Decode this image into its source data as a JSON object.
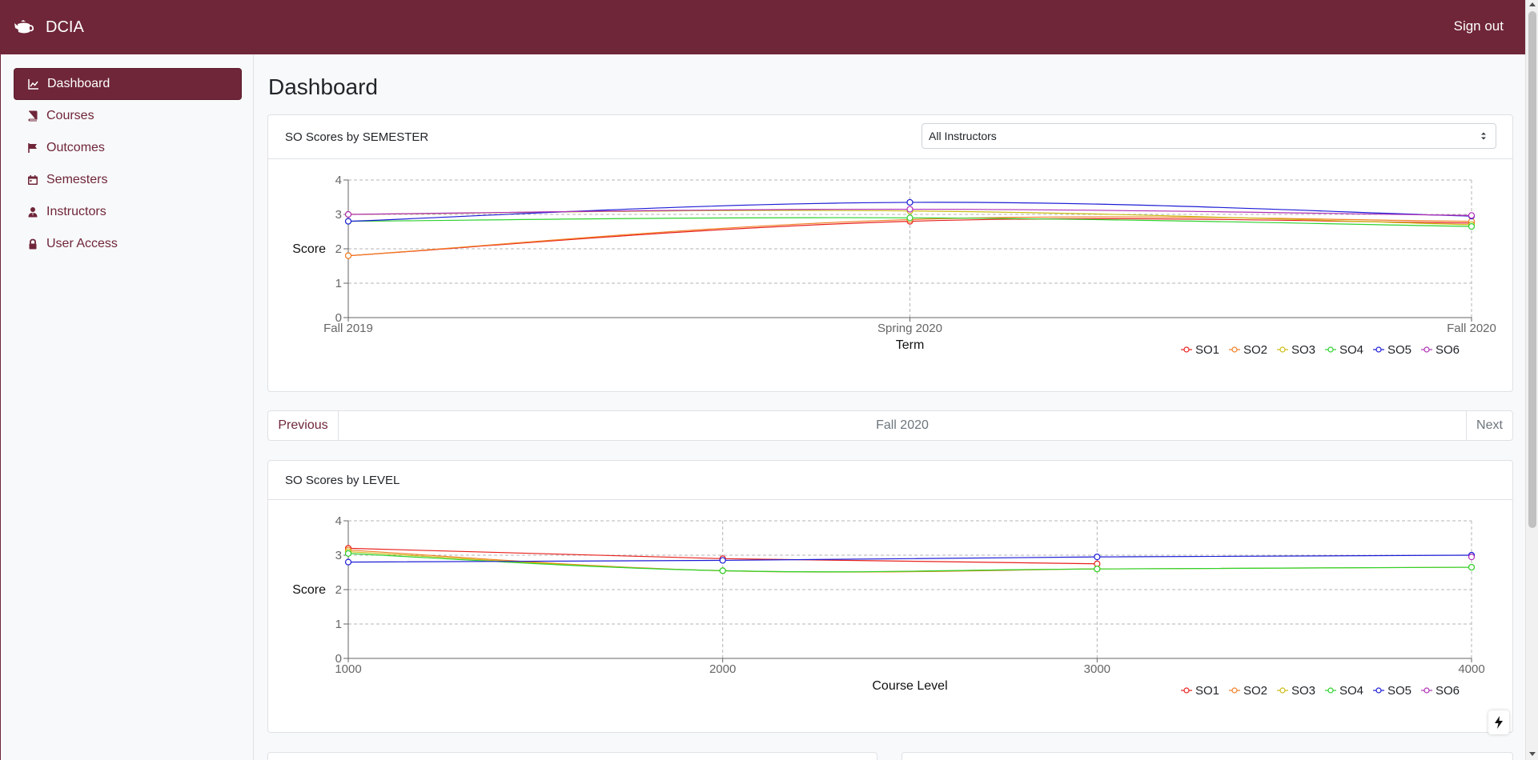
{
  "app": {
    "brand_name": "DCIA",
    "signout_label": "Sign out",
    "accent_color": "#6f2639"
  },
  "sidebar": {
    "items": [
      {
        "label": "Dashboard",
        "icon": "chart-line-icon",
        "active": true
      },
      {
        "label": "Courses",
        "icon": "book-icon",
        "active": false
      },
      {
        "label": "Outcomes",
        "icon": "flag-icon",
        "active": false
      },
      {
        "label": "Semesters",
        "icon": "calendar-icon",
        "active": false
      },
      {
        "label": "Instructors",
        "icon": "user-tie-icon",
        "active": false
      },
      {
        "label": "User Access",
        "icon": "lock-icon",
        "active": false
      }
    ]
  },
  "main": {
    "page_title": "Dashboard",
    "semester_card": {
      "title": "SO Scores by SEMESTER",
      "instructor_select_value": "All Instructors"
    },
    "pager": {
      "previous_label": "Previous",
      "current_label": "Fall 2020",
      "next_label": "Next"
    },
    "level_card": {
      "title": "SO Scores by LEVEL"
    }
  },
  "chart_data": [
    {
      "type": "line",
      "xlabel": "Term",
      "ylabel": "Score",
      "categories": [
        "Fall 2019",
        "Spring 2020",
        "Fall 2020"
      ],
      "ylim": [
        0,
        4
      ],
      "yticks": [
        0,
        1,
        2,
        3,
        4
      ],
      "grid": true,
      "legend": "bottom-right",
      "series": [
        {
          "name": "SO1",
          "color": "#e8201c",
          "values": [
            1.8,
            2.8,
            2.75
          ]
        },
        {
          "name": "SO2",
          "color": "#f07f24",
          "values": [
            1.8,
            2.85,
            2.8
          ]
        },
        {
          "name": "SO3",
          "color": "#c9bc14",
          "values": [
            3.0,
            3.1,
            2.7
          ]
        },
        {
          "name": "SO4",
          "color": "#2dd12d",
          "values": [
            2.8,
            2.9,
            2.65
          ]
        },
        {
          "name": "SO5",
          "color": "#1c1cd6",
          "values": [
            2.8,
            3.35,
            2.95
          ]
        },
        {
          "name": "SO6",
          "color": "#b02fb5",
          "values": [
            3.0,
            3.15,
            2.97
          ]
        }
      ]
    },
    {
      "type": "line",
      "xlabel": "Course Level",
      "ylabel": "Score",
      "categories": [
        "1000",
        "2000",
        "3000",
        "4000"
      ],
      "ylim": [
        0,
        4
      ],
      "yticks": [
        0,
        1,
        2,
        3,
        4
      ],
      "grid": true,
      "legend": "bottom-right",
      "series": [
        {
          "name": "SO1",
          "color": "#e8201c",
          "values": [
            3.2,
            2.9,
            2.75,
            null
          ]
        },
        {
          "name": "SO2",
          "color": "#f07f24",
          "values": [
            3.15,
            2.55,
            2.6,
            null
          ]
        },
        {
          "name": "SO3",
          "color": "#c9bc14",
          "values": [
            3.1,
            2.55,
            2.6,
            2.65
          ]
        },
        {
          "name": "SO4",
          "color": "#2dd12d",
          "values": [
            3.05,
            2.55,
            2.6,
            2.65
          ]
        },
        {
          "name": "SO5",
          "color": "#1c1cd6",
          "values": [
            2.8,
            2.85,
            2.95,
            3.0
          ]
        },
        {
          "name": "SO6",
          "color": "#b02fb5",
          "values": [
            null,
            null,
            null,
            2.95
          ]
        }
      ]
    }
  ]
}
